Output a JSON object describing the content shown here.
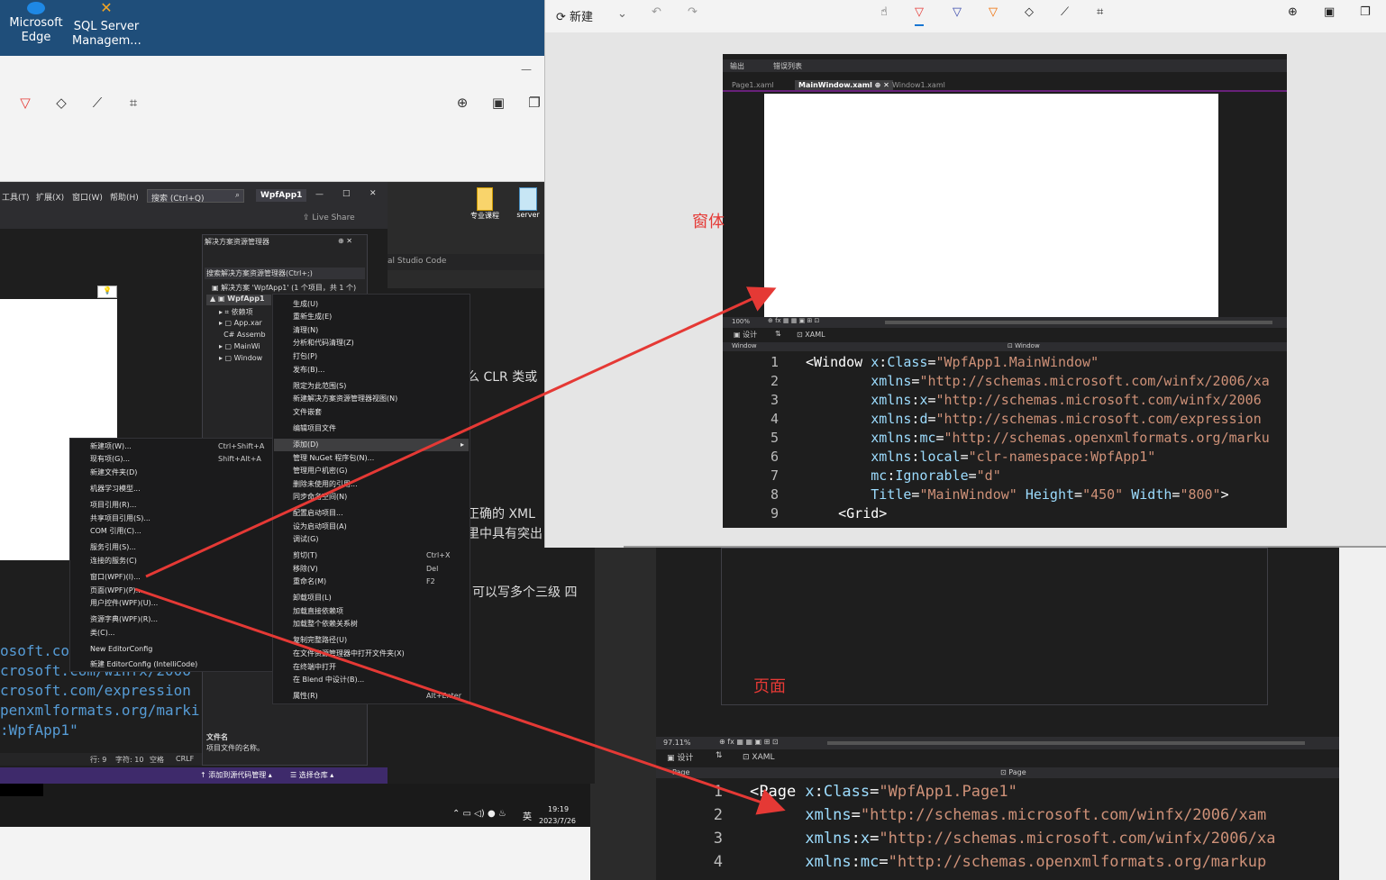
{
  "desktop": {
    "icons": [
      {
        "label_line1": "Microsoft",
        "label_line2": "Edge"
      },
      {
        "label_line1": "SQL Server",
        "label_line2": "Managem..."
      }
    ],
    "right_icons": [
      {
        "label": "专业课程"
      },
      {
        "label": "server"
      }
    ]
  },
  "vs": {
    "menu": [
      "工具(T)",
      "扩展(X)",
      "窗口(W)",
      "帮助(H)"
    ],
    "search_placeholder": "搜索 (Ctrl+Q)",
    "project_badge": "WpfApp1",
    "live_share": "Live Share",
    "solution_explorer": {
      "title": "解决方案资源管理器",
      "search_placeholder": "搜索解决方案资源管理器(Ctrl+;)",
      "solution_label": "解决方案 'WpfApp1' (1 个项目，共 1 个)",
      "project": "WpfApp1",
      "items": [
        "依赖项",
        "App.xar",
        "Assemb",
        "MainWi",
        "Window"
      ],
      "prop_title": "文件名",
      "prop_desc": "项目文件的名称。"
    },
    "vscode_hint": "al Studio Code",
    "status": {
      "line": "行: 9",
      "char": "字符: 10",
      "space": "空格",
      "eol": "CRLF",
      "add_source": "添加到源代码管理",
      "select_repo": "选择仓库"
    }
  },
  "context_menu_main": {
    "items": [
      {
        "label": "生成(U)"
      },
      {
        "label": "重新生成(E)"
      },
      {
        "label": "清理(N)"
      },
      {
        "label": "分析和代码清理(Z)"
      },
      {
        "label": "打包(P)"
      },
      {
        "label": "发布(B)..."
      },
      {
        "label": "限定为此范围(S)"
      },
      {
        "label": "新建解决方案资源管理器视图(N)"
      },
      {
        "label": "文件嵌套"
      },
      {
        "label": "编辑项目文件"
      },
      {
        "label": "添加(D)"
      },
      {
        "label": "管理 NuGet 程序包(N)..."
      },
      {
        "label": "管理用户机密(G)"
      },
      {
        "label": "删除未使用的引用..."
      },
      {
        "label": "同步命名空间(N)"
      },
      {
        "label": "配置启动项目..."
      },
      {
        "label": "设为启动项目(A)"
      },
      {
        "label": "调试(G)"
      },
      {
        "label": "剪切(T)",
        "shortcut": "Ctrl+X"
      },
      {
        "label": "移除(V)",
        "shortcut": "Del"
      },
      {
        "label": "重命名(M)",
        "shortcut": "F2"
      },
      {
        "label": "卸载项目(L)"
      },
      {
        "label": "加载直接依赖项"
      },
      {
        "label": "加载整个依赖关系树"
      },
      {
        "label": "复制完整路径(U)"
      },
      {
        "label": "在文件资源管理器中打开文件夹(X)"
      },
      {
        "label": "在终端中打开"
      },
      {
        "label": "在 Blend 中设计(B)..."
      },
      {
        "label": "属性(R)",
        "shortcut": "Alt+Enter"
      }
    ]
  },
  "context_menu_add": {
    "items": [
      {
        "label": "新建项(W)...",
        "shortcut": "Ctrl+Shift+A"
      },
      {
        "label": "现有项(G)...",
        "shortcut": "Shift+Alt+A"
      },
      {
        "label": "新建文件夹(D)"
      },
      {
        "label": "机器学习模型..."
      },
      {
        "label": "项目引用(R)..."
      },
      {
        "label": "共享项目引用(S)..."
      },
      {
        "label": "COM 引用(C)..."
      },
      {
        "label": "服务引用(S)..."
      },
      {
        "label": "连接的服务(C)"
      },
      {
        "label": "窗口(WPF)(I)..."
      },
      {
        "label": "页面(WPF)(P)..."
      },
      {
        "label": "用户控件(WPF)(U)..."
      },
      {
        "label": "资源字典(WPF)(R)..."
      },
      {
        "label": "类(C)..."
      },
      {
        "label": "New EditorConfig"
      },
      {
        "label": "新建 EditorConfig (IntelliCode)"
      }
    ]
  },
  "midtext": {
    "lines": [
      "么 CLR 类或",
      "正确的 XML",
      "里中具有突出",
      "可以写多个三级  四"
    ]
  },
  "left_code": {
    "lines": [
      "osoft.com",
      "crosoft.com/winfx/2006",
      "crosoft.com/expression",
      "penxmlformats.org/marki",
      ":WpfApp1\""
    ]
  },
  "taskbar": {
    "time": "19:19",
    "date": "2023/7/26",
    "ime": "英"
  },
  "snip": {
    "new_label": "新建",
    "tabs_top": [
      "输出",
      "错误列表"
    ],
    "doc_tabs": [
      "Page1.xaml",
      "MainWindow.xaml",
      "Window1.xaml"
    ],
    "zoom": "100%",
    "design_tab": "设计",
    "xaml_tab": "XAML",
    "scope_left": "Window",
    "scope_right": "Window",
    "code": [
      {
        "n": "1",
        "text_parts": [
          [
            "el",
            "<"
          ],
          [
            "el",
            "Window "
          ],
          [
            "at",
            "x"
          ],
          [
            "el",
            ":"
          ],
          [
            "at",
            "Class"
          ],
          [
            "el",
            "="
          ],
          [
            "st",
            "\"WpfApp1.MainWindow\""
          ]
        ]
      },
      {
        "n": "2",
        "text_parts": [
          [
            "at",
            "        xmlns"
          ],
          [
            "el",
            "="
          ],
          [
            "st",
            "\"http://schemas.microsoft.com/winfx/2006/xa"
          ]
        ]
      },
      {
        "n": "3",
        "text_parts": [
          [
            "at",
            "        xmlns"
          ],
          [
            "el",
            ":"
          ],
          [
            "at",
            "x"
          ],
          [
            "el",
            "="
          ],
          [
            "st",
            "\"http://schemas.microsoft.com/winfx/2006"
          ]
        ]
      },
      {
        "n": "4",
        "text_parts": [
          [
            "at",
            "        xmlns"
          ],
          [
            "el",
            ":"
          ],
          [
            "at",
            "d"
          ],
          [
            "el",
            "="
          ],
          [
            "st",
            "\"http://schemas.microsoft.com/expression"
          ]
        ]
      },
      {
        "n": "5",
        "text_parts": [
          [
            "at",
            "        xmlns"
          ],
          [
            "el",
            ":"
          ],
          [
            "at",
            "mc"
          ],
          [
            "el",
            "="
          ],
          [
            "st",
            "\"http://schemas.openxmlformats.org/marku"
          ]
        ]
      },
      {
        "n": "6",
        "text_parts": [
          [
            "at",
            "        xmlns"
          ],
          [
            "el",
            ":"
          ],
          [
            "at",
            "local"
          ],
          [
            "el",
            "="
          ],
          [
            "st",
            "\"clr-namespace:WpfApp1\""
          ]
        ]
      },
      {
        "n": "7",
        "text_parts": [
          [
            "at",
            "        mc"
          ],
          [
            "el",
            ":"
          ],
          [
            "at",
            "Ignorable"
          ],
          [
            "el",
            "="
          ],
          [
            "st",
            "\"d\""
          ]
        ]
      },
      {
        "n": "8",
        "text_parts": [
          [
            "at",
            "        Title"
          ],
          [
            "el",
            "="
          ],
          [
            "st",
            "\"MainWindow\""
          ],
          [
            "at",
            " Height"
          ],
          [
            "el",
            "="
          ],
          [
            "st",
            "\"450\""
          ],
          [
            "at",
            " Width"
          ],
          [
            "el",
            "="
          ],
          [
            "st",
            "\"800\""
          ],
          [
            "el",
            ">"
          ]
        ]
      },
      {
        "n": "9",
        "text_parts": [
          [
            "el",
            "    <Grid>"
          ]
        ]
      }
    ]
  },
  "annotations": {
    "window_label": "窗体",
    "page_label": "页面"
  },
  "page_editor": {
    "zoom": "97.11%",
    "design_tab": "设计",
    "xaml_tab": "XAML",
    "scope_left": "Page",
    "scope_right": "Page",
    "code": [
      {
        "n": "1",
        "text_parts": [
          [
            "el",
            "<Page "
          ],
          [
            "at",
            "x"
          ],
          [
            "el",
            ":"
          ],
          [
            "at",
            "Class"
          ],
          [
            "el",
            "="
          ],
          [
            "st",
            "\"WpfApp1.Page1\""
          ]
        ]
      },
      {
        "n": "2",
        "text_parts": [
          [
            "at",
            "      xmlns"
          ],
          [
            "el",
            "="
          ],
          [
            "st",
            "\"http://schemas.microsoft.com/winfx/2006/xam"
          ]
        ]
      },
      {
        "n": "3",
        "text_parts": [
          [
            "at",
            "      xmlns"
          ],
          [
            "el",
            ":"
          ],
          [
            "at",
            "x"
          ],
          [
            "el",
            "="
          ],
          [
            "st",
            "\"http://schemas.microsoft.com/winfx/2006/xa"
          ]
        ]
      },
      {
        "n": "4",
        "text_parts": [
          [
            "at",
            "      xmlns"
          ],
          [
            "el",
            ":"
          ],
          [
            "at",
            "mc"
          ],
          [
            "el",
            "="
          ],
          [
            "st",
            "\"http://schemas.openxmlformats.org/markup"
          ]
        ]
      }
    ]
  },
  "colors": {
    "arrow": "#e53935",
    "vs_accent": "#68217a",
    "annotation": "#e53935"
  }
}
